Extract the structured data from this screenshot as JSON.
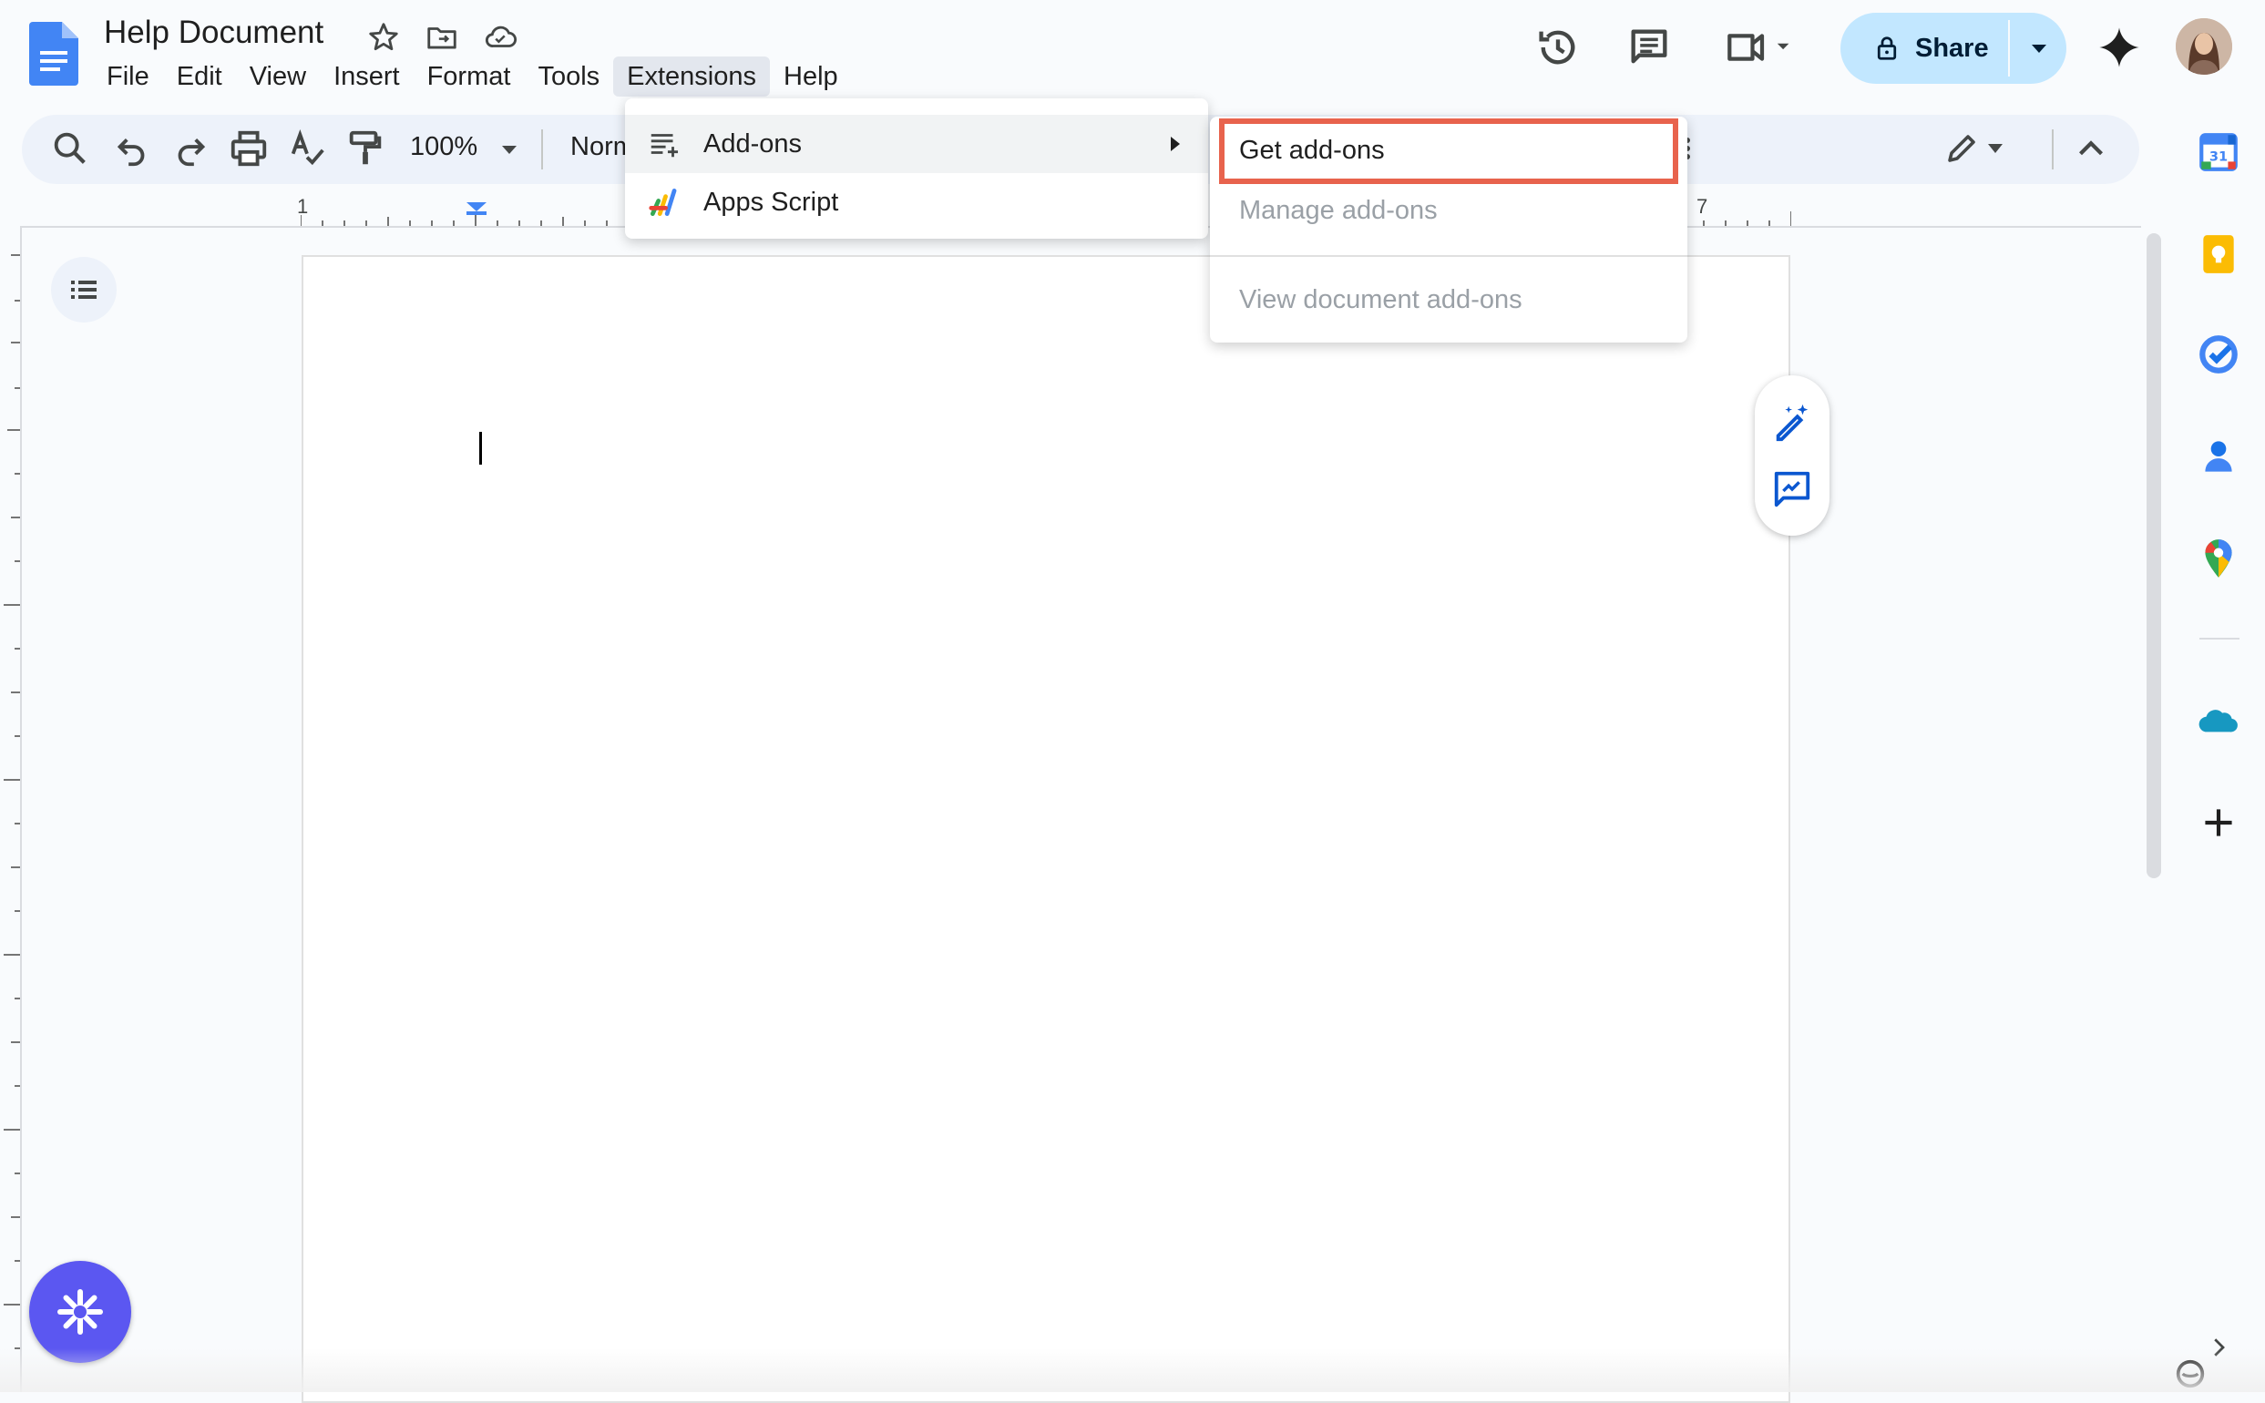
{
  "doc": {
    "title": "Help Document"
  },
  "menubar": [
    "File",
    "Edit",
    "View",
    "Insert",
    "Format",
    "Tools",
    "Extensions",
    "Help"
  ],
  "active_menu": "Extensions",
  "share": {
    "label": "Share"
  },
  "toolbar": {
    "zoom": "100%",
    "style": "Normal text"
  },
  "ruler": {
    "labels": [
      "1",
      "7"
    ]
  },
  "extensions_menu": {
    "items": [
      {
        "label": "Add-ons",
        "icon": "add-ons-icon",
        "has_submenu": true
      },
      {
        "label": "Apps Script",
        "icon": "apps-script-icon",
        "has_submenu": false
      }
    ]
  },
  "addons_submenu": {
    "items": [
      {
        "label": "Get add-ons",
        "enabled": true,
        "highlighted": true
      },
      {
        "label": "Manage add-ons",
        "enabled": false
      },
      {
        "label": "View document add-ons",
        "enabled": false
      }
    ]
  },
  "colors": {
    "highlight": "#e8634d",
    "share_bg": "#c2e7ff",
    "docs_blue": "#4285f4",
    "fab": "#5b57f1"
  }
}
